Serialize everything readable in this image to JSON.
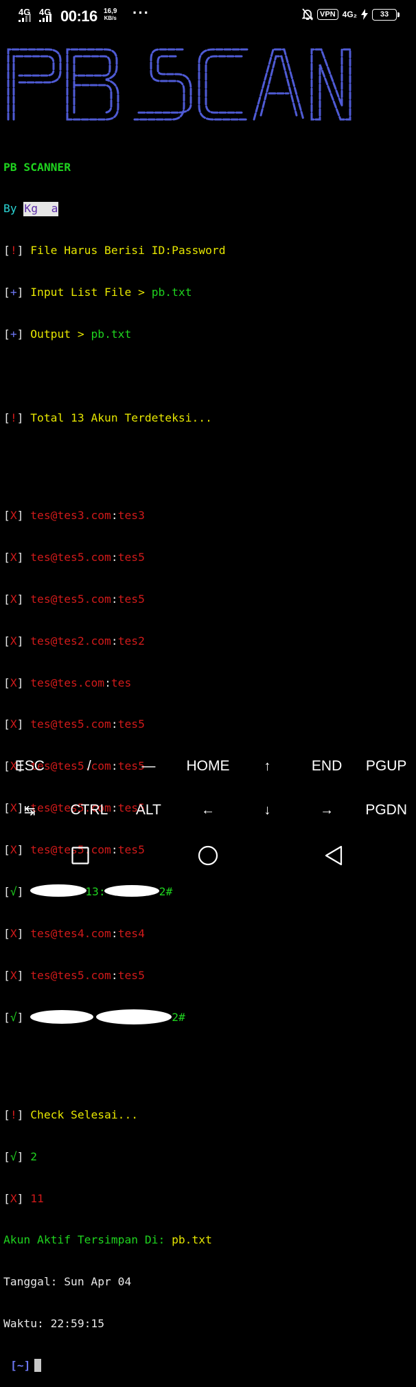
{
  "status_bar": {
    "net1": "4G",
    "net2": "4G",
    "time": "00:16",
    "speed_value": "16,9",
    "speed_unit": "KB/s",
    "more": "···",
    "vpn": "VPN",
    "net3": "4G₂",
    "battery": "33"
  },
  "banner": {
    "text": "PB SCAN",
    "color": "#4f5bd5"
  },
  "terminal": {
    "title": "PB SCANNER",
    "by_label": "By ",
    "author": "Kg  a",
    "info1_text": "File Harus Berisi ID:Password",
    "info2_text": "Input List File > ",
    "info2_file": "pb.txt",
    "info3_text": "Output > ",
    "info3_file": "pb.txt",
    "total_text": "Total 13 Akun Terdeteksi...",
    "accounts": [
      {
        "mark": "X",
        "user": "tes@tes3.com",
        "pass": "tes3"
      },
      {
        "mark": "X",
        "user": "tes@tes5.com",
        "pass": "tes5"
      },
      {
        "mark": "X",
        "user": "tes@tes5.com",
        "pass": "tes5"
      },
      {
        "mark": "X",
        "user": "tes@tes2.com",
        "pass": "tes2"
      },
      {
        "mark": "X",
        "user": "tes@tes.com",
        "pass": "tes"
      },
      {
        "mark": "X",
        "user": "tes@tes5.com",
        "pass": "tes5"
      },
      {
        "mark": "X",
        "user": "tes@tes5.com",
        "pass": "tes5"
      },
      {
        "mark": "X",
        "user": "tes@tes5.com",
        "pass": "tes5"
      },
      {
        "mark": "X",
        "user": "tes@tes5.com",
        "pass": "tes5"
      },
      {
        "mark": "√",
        "user": "13",
        "pass": "2#"
      },
      {
        "mark": "X",
        "user": "tes@tes4.com",
        "pass": "tes4"
      },
      {
        "mark": "X",
        "user": "tes@tes5.com",
        "pass": "tes5"
      },
      {
        "mark": "√",
        "user": "",
        "pass": "2#"
      }
    ],
    "check_done": "Check Selesai...",
    "ok_count": "2",
    "fail_count": "11",
    "saved_label": "Akun Aktif Tersimpan Di: ",
    "saved_file": "pb.txt",
    "date_line": "Tanggal: Sun Apr 04",
    "time_line": "Waktu: 22:59:15",
    "prompt": "[~]"
  },
  "extra_keys": {
    "row1": [
      "ESC",
      "/",
      "—",
      "HOME",
      "↑",
      "END",
      "PGUP"
    ],
    "row2": [
      "↹",
      "CTRL",
      "ALT",
      "←",
      "↓",
      "→",
      "PGDN"
    ]
  },
  "nav": {
    "icons": [
      "recents-icon",
      "home-icon",
      "back-icon"
    ]
  }
}
